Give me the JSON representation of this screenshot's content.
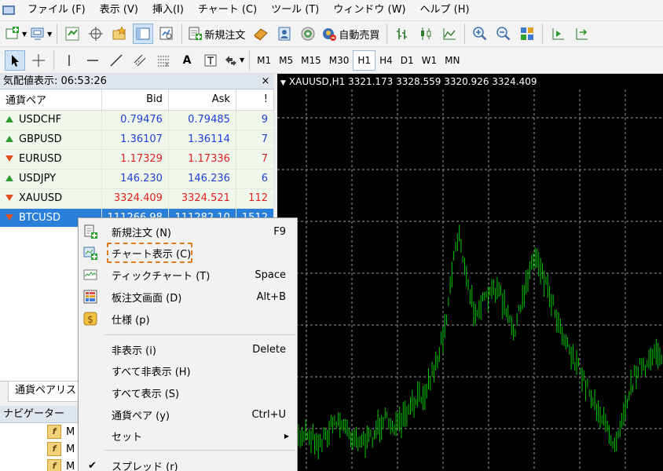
{
  "menubar": {
    "items": [
      "ファイル (F)",
      "表示 (V)",
      "挿入(I)",
      "チャート (C)",
      "ツール (T)",
      "ウィンドウ (W)",
      "ヘルプ (H)"
    ]
  },
  "toolbar1": {
    "new_order_label": "新規注文",
    "auto_trade_label": "自動売買"
  },
  "toolbar2": {
    "timeframes": [
      "M1",
      "M5",
      "M15",
      "M30",
      "H1",
      "H4",
      "D1",
      "W1",
      "MN"
    ],
    "active_timeframe": "H1",
    "text_tool": "A"
  },
  "market_watch": {
    "title": "気配値表示: 06:53:26",
    "close_glyph": "×",
    "columns": {
      "symbol": "通貨ペア",
      "bid": "Bid",
      "ask": "Ask",
      "spread": "!"
    },
    "rows": [
      {
        "symbol": "USDCHF",
        "bid": "0.79476",
        "ask": "0.79485",
        "spread": "9",
        "dir": "up",
        "color": "blue"
      },
      {
        "symbol": "GBPUSD",
        "bid": "1.36107",
        "ask": "1.36114",
        "spread": "7",
        "dir": "up",
        "color": "blue"
      },
      {
        "symbol": "EURUSD",
        "bid": "1.17329",
        "ask": "1.17336",
        "spread": "7",
        "dir": "down",
        "color": "red"
      },
      {
        "symbol": "USDJPY",
        "bid": "146.230",
        "ask": "146.236",
        "spread": "6",
        "dir": "up",
        "color": "blue"
      },
      {
        "symbol": "XAUUSD",
        "bid": "3324.409",
        "ask": "3324.521",
        "spread": "112",
        "dir": "down",
        "color": "red"
      },
      {
        "symbol": "BTCUSD",
        "bid": "111266.98",
        "ask": "111282.10",
        "spread": "1512",
        "dir": "down",
        "color": "red",
        "selected": true
      }
    ],
    "tab_symbols": "通貨ペアリスト"
  },
  "navigator": {
    "title": "ナビゲーター",
    "items": [
      "M",
      "M",
      "M"
    ]
  },
  "chart": {
    "title": "XAUUSD,H1  3321.173 3328.559 3320.926 3324.409",
    "bar_color": "#00c800",
    "grid_color": "#9a9a9a"
  },
  "context_menu": {
    "items": [
      {
        "label": "新規注文 (N)",
        "key": "F9",
        "icon": "new-order-icon"
      },
      {
        "label": "チャート表示 (C)",
        "key": "",
        "icon": "chart-window-icon",
        "highlighted": true
      },
      {
        "label": "ティックチャート (T)",
        "key": "Space",
        "icon": "tick-chart-icon"
      },
      {
        "label": "板注文画面 (D)",
        "key": "Alt+B",
        "icon": "depth-of-market-icon"
      },
      {
        "label": "仕様 (p)",
        "key": "",
        "icon": "specification-icon"
      },
      {
        "label": "非表示 (i)",
        "key": "Delete",
        "icon": ""
      },
      {
        "label": "すべて非表示 (H)",
        "key": "",
        "icon": ""
      },
      {
        "label": "すべて表示 (S)",
        "key": "",
        "icon": ""
      },
      {
        "label": "通貨ペア (y)",
        "key": "Ctrl+U",
        "icon": ""
      },
      {
        "label": "セット",
        "key": "",
        "icon": "",
        "submenu": true
      },
      {
        "label": "スプレッド (r)",
        "key": "",
        "icon": "",
        "checked": true
      }
    ]
  }
}
